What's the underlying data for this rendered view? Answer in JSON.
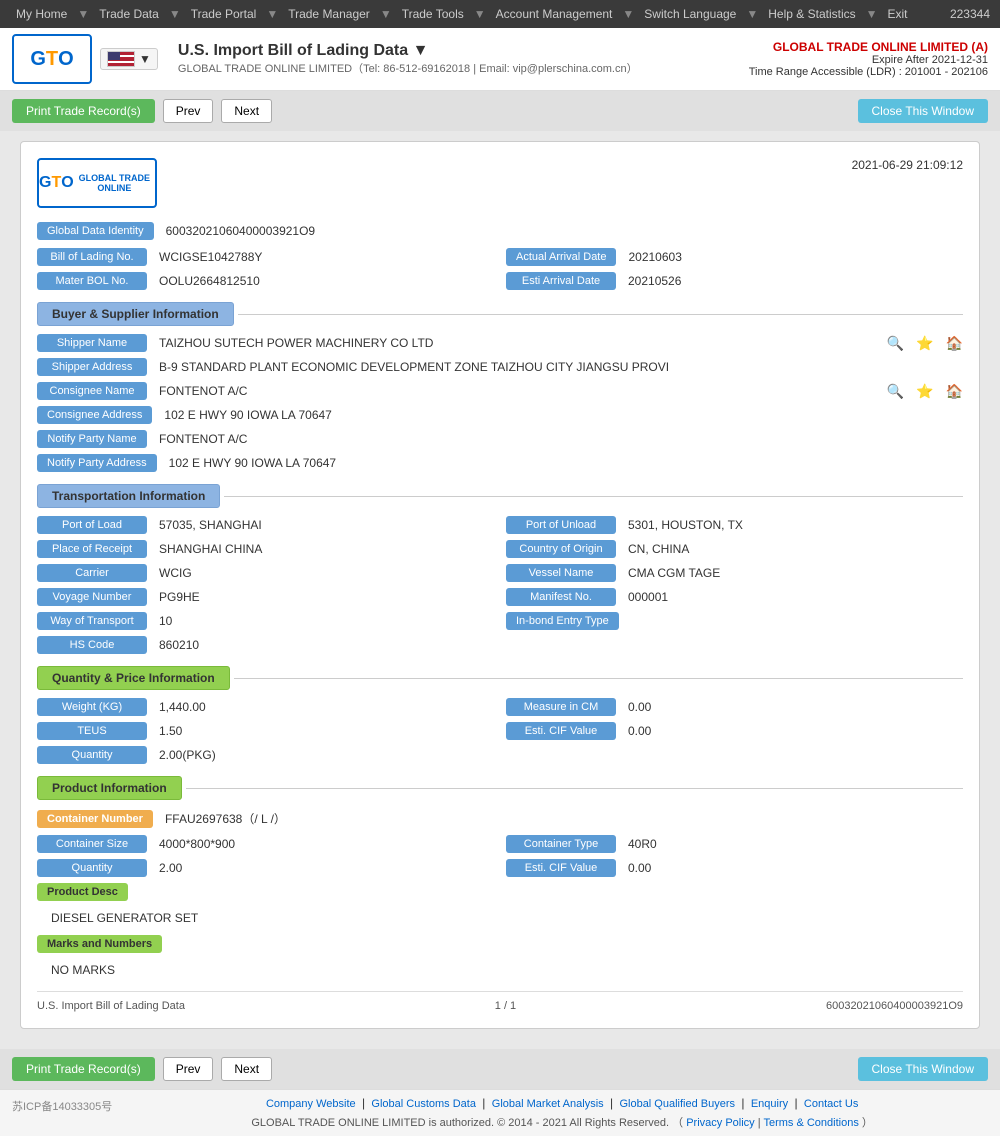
{
  "topNav": {
    "items": [
      "My Home",
      "Trade Data",
      "Trade Portal",
      "Trade Manager",
      "Trade Tools",
      "Account Management",
      "Switch Language",
      "Help & Statistics",
      "Exit"
    ],
    "userCode": "223344"
  },
  "header": {
    "logoText": "GTO",
    "flagAlt": "US Flag",
    "title": "U.S. Import Bill of Lading Data ▼",
    "subtitle": "GLOBAL TRADE ONLINE LIMITED（Tel: 86-512-69162018 | Email: vip@plerschina.com.cn）",
    "companyName": "GLOBAL TRADE ONLINE LIMITED (A)",
    "expire": "Expire After 2021-12-31",
    "timeRange": "Time Range Accessible (LDR) : 201001 - 202106"
  },
  "actionBar": {
    "printLabel": "Print Trade Record(s)",
    "prevLabel": "Prev",
    "nextLabel": "Next",
    "closeLabel": "Close This Window"
  },
  "record": {
    "datetime": "2021-06-29 21:09:12",
    "globalDataIdentityLabel": "Global Data Identity",
    "globalDataIdentityValue": "60032021060400003921O9",
    "billOfLadingLabel": "Bill of Lading No.",
    "billOfLadingValue": "WCIGSE1042788Y",
    "actualArrivalLabel": "Actual Arrival Date",
    "actualArrivalValue": "20210603",
    "materBOLLabel": "Mater BOL No.",
    "materBOLValue": "OOLU2664812510",
    "estiArrivalLabel": "Esti Arrival Date",
    "estiArrivalValue": "20210526"
  },
  "buyerSupplier": {
    "sectionTitle": "Buyer & Supplier Information",
    "shipperNameLabel": "Shipper Name",
    "shipperNameValue": "TAIZHOU SUTECH POWER MACHINERY CO LTD",
    "shipperAddressLabel": "Shipper Address",
    "shipperAddressValue": "B-9 STANDARD PLANT ECONOMIC DEVELOPMENT ZONE TAIZHOU CITY JIANGSU PROVI",
    "consigneeNameLabel": "Consignee Name",
    "consigneeNameValue": "FONTENOT A/C",
    "consigneeAddressLabel": "Consignee Address",
    "consigneeAddressValue": "102 E HWY 90 IOWA LA 70647",
    "notifyPartyNameLabel": "Notify Party Name",
    "notifyPartyNameValue": "FONTENOT A/C",
    "notifyPartyAddressLabel": "Notify Party Address",
    "notifyPartyAddressValue": "102 E HWY 90 IOWA LA 70647"
  },
  "transportation": {
    "sectionTitle": "Transportation Information",
    "portOfLoadLabel": "Port of Load",
    "portOfLoadValue": "57035, SHANGHAI",
    "portOfUnloadLabel": "Port of Unload",
    "portOfUnloadValue": "5301, HOUSTON, TX",
    "placeOfReceiptLabel": "Place of Receipt",
    "placeOfReceiptValue": "SHANGHAI CHINA",
    "countryOfOriginLabel": "Country of Origin",
    "countryOfOriginValue": "CN, CHINA",
    "carrierLabel": "Carrier",
    "carrierValue": "WCIG",
    "vesselNameLabel": "Vessel Name",
    "vesselNameValue": "CMA CGM TAGE",
    "voyageNumberLabel": "Voyage Number",
    "voyageNumberValue": "PG9HE",
    "manifestNoLabel": "Manifest No.",
    "manifestNoValue": "000001",
    "wayOfTransportLabel": "Way of Transport",
    "wayOfTransportValue": "10",
    "inBondEntryTypeLabel": "In-bond Entry Type",
    "inBondEntryTypeValue": "",
    "hsCodeLabel": "HS Code",
    "hsCodeValue": "860210"
  },
  "quantity": {
    "sectionTitle": "Quantity & Price Information",
    "weightLabel": "Weight (KG)",
    "weightValue": "1,440.00",
    "measureInCMLabel": "Measure in CM",
    "measureInCMValue": "0.00",
    "teusLabel": "TEUS",
    "teusValue": "1.50",
    "estiCIFLabel": "Esti. CIF Value",
    "estiCIFValue": "0.00",
    "quantityLabel": "Quantity",
    "quantityValue": "2.00(PKG)"
  },
  "product": {
    "sectionTitle": "Product Information",
    "containerNumberLabel": "Container Number",
    "containerNumberValue": "FFAU2697638（/ L /）",
    "containerSizeLabel": "Container Size",
    "containerSizeValue": "4000*800*900",
    "containerTypeLabel": "Container Type",
    "containerTypeValue": "40R0",
    "quantityLabel": "Quantity",
    "quantityValue": "2.00",
    "estiCIFLabel": "Esti. CIF Value",
    "estiCIFValue": "0.00",
    "productDescLabel": "Product Desc",
    "productDescValue": "DIESEL GENERATOR SET",
    "marksAndNumbersLabel": "Marks and Numbers",
    "marksAndNumbersValue": "NO MARKS"
  },
  "footer": {
    "recordLabel": "U.S. Import Bill of Lading Data",
    "pageInfo": "1 / 1",
    "recordId": "60032021060400003921O9",
    "printLabel": "Print Trade Record(s)",
    "prevLabel": "Prev",
    "nextLabel": "Next",
    "closeLabel": "Close This Window"
  },
  "pageFooter": {
    "icp": "苏ICP备14033305号",
    "links": [
      "Company Website",
      "Global Customs Data",
      "Global Market Analysis",
      "Global Qualified Buyers",
      "Enquiry",
      "Contact Us"
    ],
    "copyright": "GLOBAL TRADE ONLINE LIMITED is authorized. © 2014 - 2021 All Rights Reserved.",
    "privacyLabel": "Privacy Policy",
    "termsLabel": "Terms & Conditions"
  }
}
